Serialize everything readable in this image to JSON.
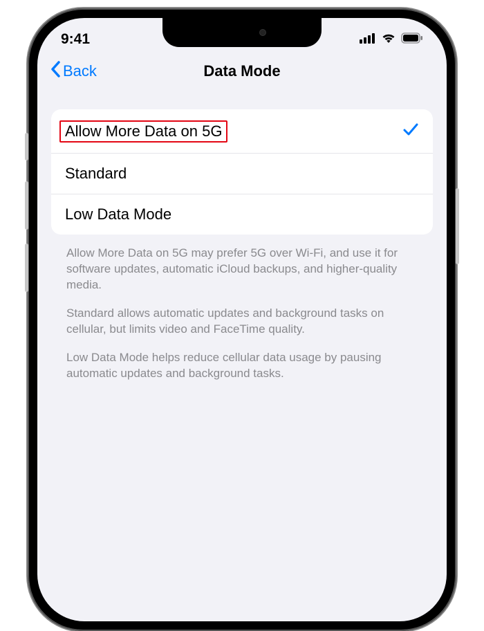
{
  "status": {
    "time": "9:41"
  },
  "nav": {
    "back_label": "Back",
    "title": "Data Mode"
  },
  "options": {
    "row0": {
      "label": "Allow More Data on 5G",
      "selected": true
    },
    "row1": {
      "label": "Standard",
      "selected": false
    },
    "row2": {
      "label": "Low Data Mode",
      "selected": false
    }
  },
  "footer": {
    "p0": "Allow More Data on 5G may prefer 5G over Wi-Fi, and use it for software updates, automatic iCloud backups, and higher-quality media.",
    "p1": "Standard allows automatic updates and background tasks on cellular, but limits video and FaceTime quality.",
    "p2": "Low Data Mode helps reduce cellular data usage by pausing automatic updates and background tasks."
  }
}
